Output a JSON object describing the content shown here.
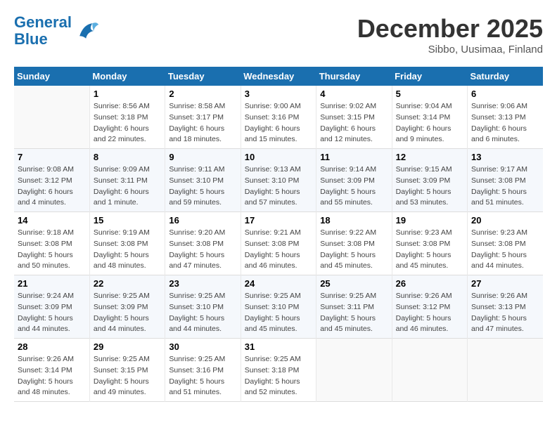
{
  "header": {
    "logo_line1": "General",
    "logo_line2": "Blue",
    "month_title": "December 2025",
    "location": "Sibbo, Uusimaa, Finland"
  },
  "weekdays": [
    "Sunday",
    "Monday",
    "Tuesday",
    "Wednesday",
    "Thursday",
    "Friday",
    "Saturday"
  ],
  "weeks": [
    [
      {
        "day": "",
        "info": ""
      },
      {
        "day": "1",
        "info": "Sunrise: 8:56 AM\nSunset: 3:18 PM\nDaylight: 6 hours\nand 22 minutes."
      },
      {
        "day": "2",
        "info": "Sunrise: 8:58 AM\nSunset: 3:17 PM\nDaylight: 6 hours\nand 18 minutes."
      },
      {
        "day": "3",
        "info": "Sunrise: 9:00 AM\nSunset: 3:16 PM\nDaylight: 6 hours\nand 15 minutes."
      },
      {
        "day": "4",
        "info": "Sunrise: 9:02 AM\nSunset: 3:15 PM\nDaylight: 6 hours\nand 12 minutes."
      },
      {
        "day": "5",
        "info": "Sunrise: 9:04 AM\nSunset: 3:14 PM\nDaylight: 6 hours\nand 9 minutes."
      },
      {
        "day": "6",
        "info": "Sunrise: 9:06 AM\nSunset: 3:13 PM\nDaylight: 6 hours\nand 6 minutes."
      }
    ],
    [
      {
        "day": "7",
        "info": "Sunrise: 9:08 AM\nSunset: 3:12 PM\nDaylight: 6 hours\nand 4 minutes."
      },
      {
        "day": "8",
        "info": "Sunrise: 9:09 AM\nSunset: 3:11 PM\nDaylight: 6 hours\nand 1 minute."
      },
      {
        "day": "9",
        "info": "Sunrise: 9:11 AM\nSunset: 3:10 PM\nDaylight: 5 hours\nand 59 minutes."
      },
      {
        "day": "10",
        "info": "Sunrise: 9:13 AM\nSunset: 3:10 PM\nDaylight: 5 hours\nand 57 minutes."
      },
      {
        "day": "11",
        "info": "Sunrise: 9:14 AM\nSunset: 3:09 PM\nDaylight: 5 hours\nand 55 minutes."
      },
      {
        "day": "12",
        "info": "Sunrise: 9:15 AM\nSunset: 3:09 PM\nDaylight: 5 hours\nand 53 minutes."
      },
      {
        "day": "13",
        "info": "Sunrise: 9:17 AM\nSunset: 3:08 PM\nDaylight: 5 hours\nand 51 minutes."
      }
    ],
    [
      {
        "day": "14",
        "info": "Sunrise: 9:18 AM\nSunset: 3:08 PM\nDaylight: 5 hours\nand 50 minutes."
      },
      {
        "day": "15",
        "info": "Sunrise: 9:19 AM\nSunset: 3:08 PM\nDaylight: 5 hours\nand 48 minutes."
      },
      {
        "day": "16",
        "info": "Sunrise: 9:20 AM\nSunset: 3:08 PM\nDaylight: 5 hours\nand 47 minutes."
      },
      {
        "day": "17",
        "info": "Sunrise: 9:21 AM\nSunset: 3:08 PM\nDaylight: 5 hours\nand 46 minutes."
      },
      {
        "day": "18",
        "info": "Sunrise: 9:22 AM\nSunset: 3:08 PM\nDaylight: 5 hours\nand 45 minutes."
      },
      {
        "day": "19",
        "info": "Sunrise: 9:23 AM\nSunset: 3:08 PM\nDaylight: 5 hours\nand 45 minutes."
      },
      {
        "day": "20",
        "info": "Sunrise: 9:23 AM\nSunset: 3:08 PM\nDaylight: 5 hours\nand 44 minutes."
      }
    ],
    [
      {
        "day": "21",
        "info": "Sunrise: 9:24 AM\nSunset: 3:09 PM\nDaylight: 5 hours\nand 44 minutes."
      },
      {
        "day": "22",
        "info": "Sunrise: 9:25 AM\nSunset: 3:09 PM\nDaylight: 5 hours\nand 44 minutes."
      },
      {
        "day": "23",
        "info": "Sunrise: 9:25 AM\nSunset: 3:10 PM\nDaylight: 5 hours\nand 44 minutes."
      },
      {
        "day": "24",
        "info": "Sunrise: 9:25 AM\nSunset: 3:10 PM\nDaylight: 5 hours\nand 45 minutes."
      },
      {
        "day": "25",
        "info": "Sunrise: 9:25 AM\nSunset: 3:11 PM\nDaylight: 5 hours\nand 45 minutes."
      },
      {
        "day": "26",
        "info": "Sunrise: 9:26 AM\nSunset: 3:12 PM\nDaylight: 5 hours\nand 46 minutes."
      },
      {
        "day": "27",
        "info": "Sunrise: 9:26 AM\nSunset: 3:13 PM\nDaylight: 5 hours\nand 47 minutes."
      }
    ],
    [
      {
        "day": "28",
        "info": "Sunrise: 9:26 AM\nSunset: 3:14 PM\nDaylight: 5 hours\nand 48 minutes."
      },
      {
        "day": "29",
        "info": "Sunrise: 9:25 AM\nSunset: 3:15 PM\nDaylight: 5 hours\nand 49 minutes."
      },
      {
        "day": "30",
        "info": "Sunrise: 9:25 AM\nSunset: 3:16 PM\nDaylight: 5 hours\nand 51 minutes."
      },
      {
        "day": "31",
        "info": "Sunrise: 9:25 AM\nSunset: 3:18 PM\nDaylight: 5 hours\nand 52 minutes."
      },
      {
        "day": "",
        "info": ""
      },
      {
        "day": "",
        "info": ""
      },
      {
        "day": "",
        "info": ""
      }
    ]
  ]
}
